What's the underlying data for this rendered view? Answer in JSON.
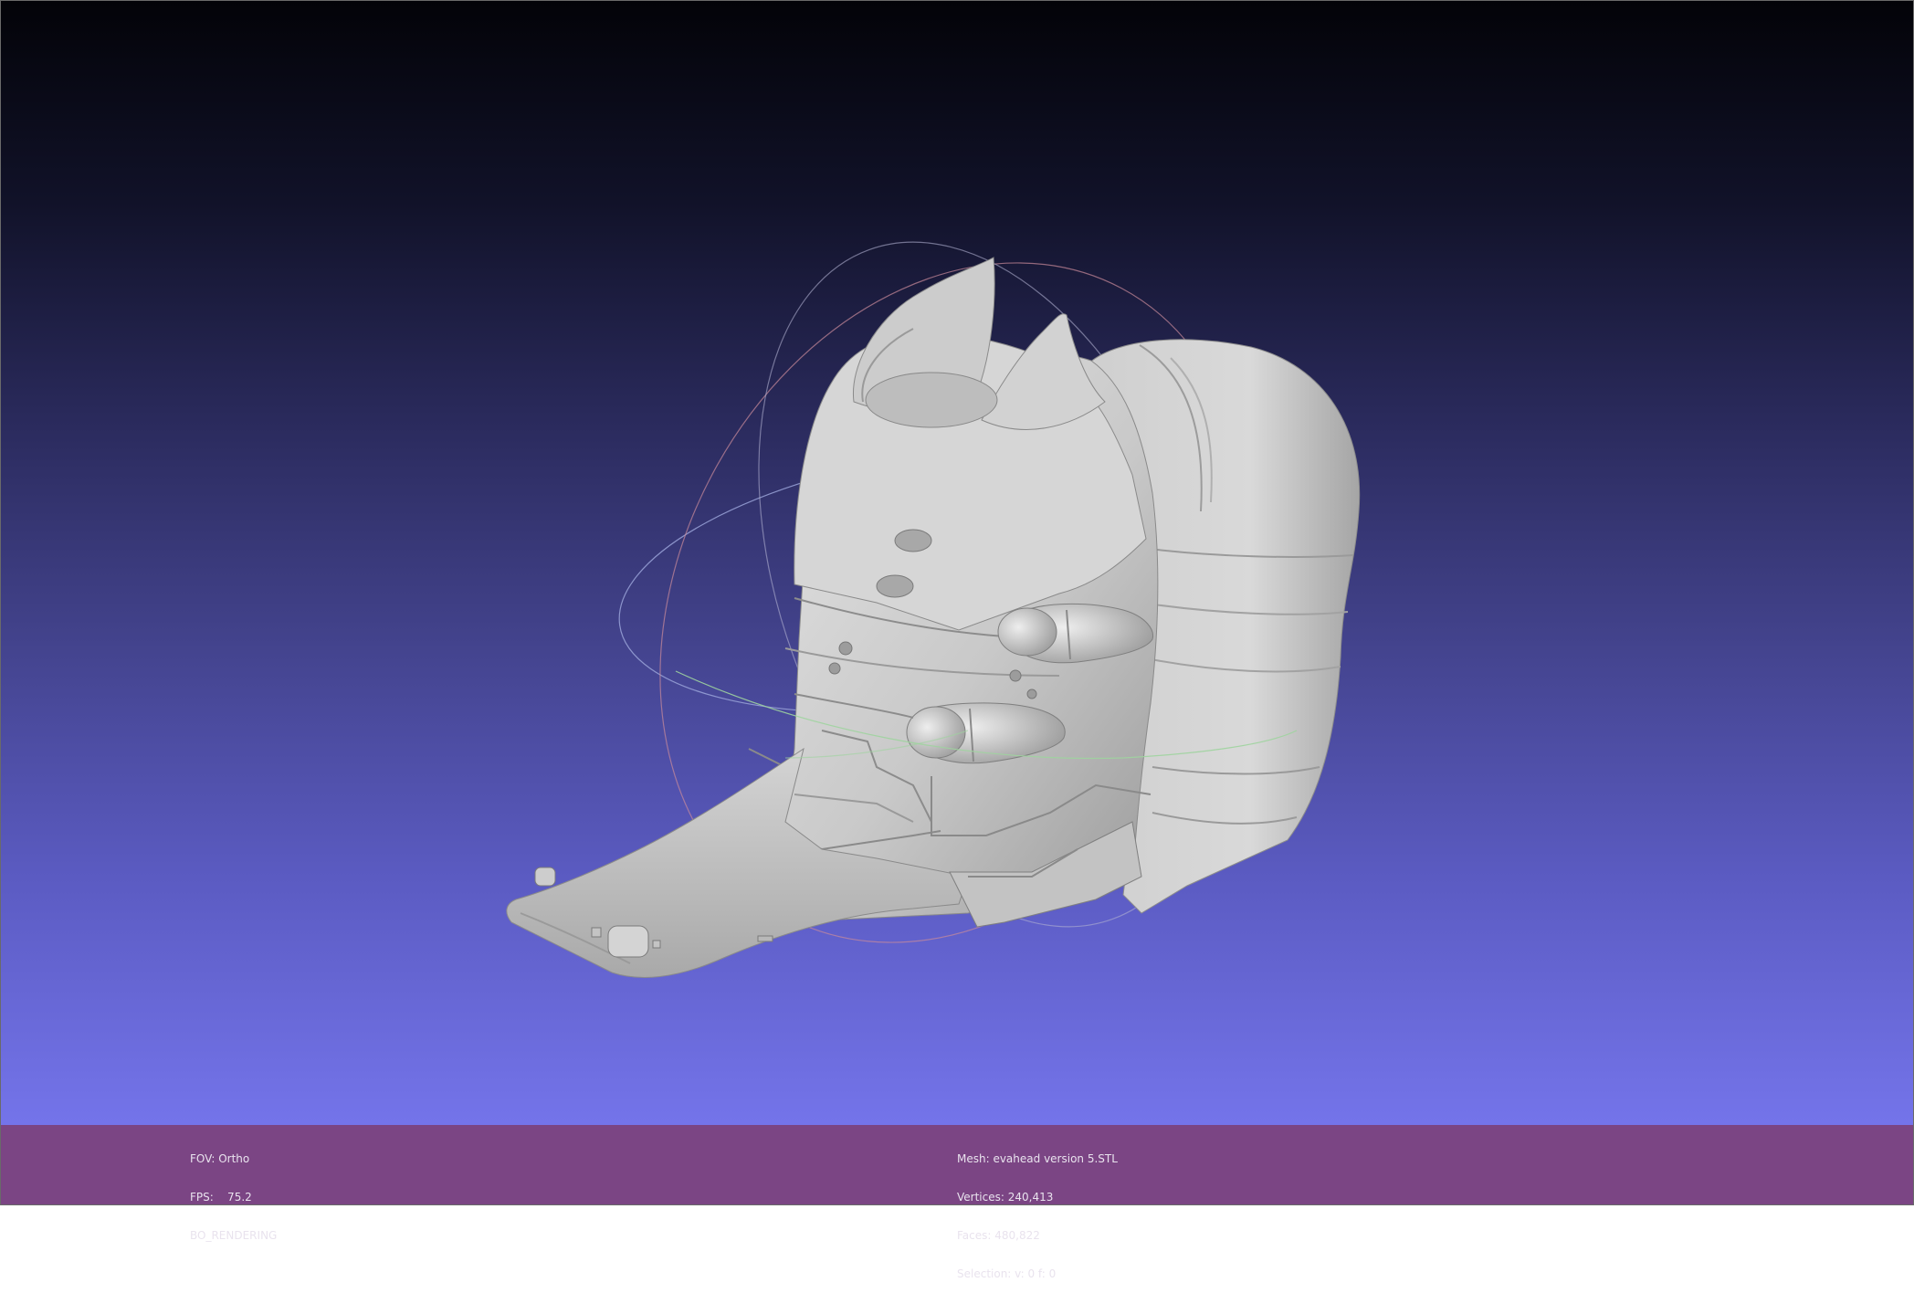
{
  "viewer": {
    "mesh_description": "evahead version 5.STL"
  },
  "left_info": {
    "fov": "FOV: Ortho",
    "fps": "FPS:    75.2",
    "mode": "BO_RENDERING"
  },
  "right_info": {
    "mesh": "Mesh: evahead version 5.STL",
    "vertices": "Vertices: 240,413",
    "faces": "Faces: 480,822",
    "selection": "Selection: v: 0 f: 0"
  },
  "colors": {
    "background_top": "#030308",
    "background_bottom": "#7474ea",
    "info_bar": "#7b4584",
    "info_text": "#e9e3ee",
    "mesh": "#cfcfcf",
    "trackball_red": "#c98a9a",
    "trackball_green": "#9fd49f",
    "trackball_blue": "#9aa3d8"
  },
  "icons": [
    "trackball-icon"
  ]
}
